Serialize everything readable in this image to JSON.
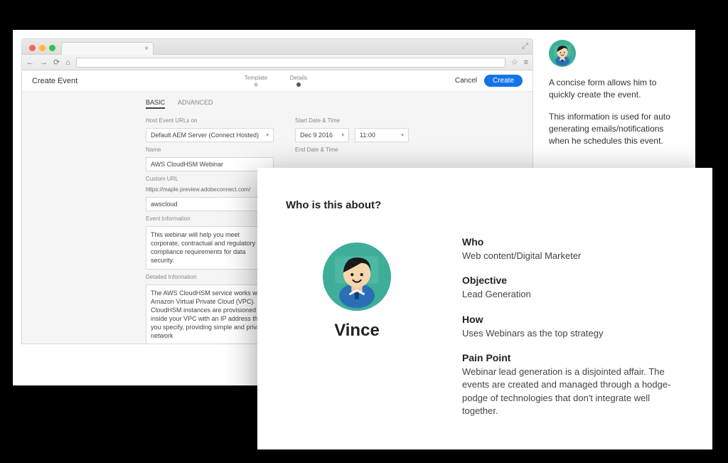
{
  "card1": {
    "browser": {
      "tab_close": "×",
      "nav_back": "←",
      "nav_fwd": "→",
      "nav_reload": "⟳",
      "nav_home": "⌂",
      "star": "☆",
      "expand": "⤢"
    },
    "header": {
      "title": "Create Event",
      "step1": "Template",
      "step2": "Details",
      "cancel": "Cancel",
      "create": "Create"
    },
    "tabs": {
      "basic": "BASIC",
      "advanced": "ADVANCED"
    },
    "left": {
      "host_label": "Host Event URLs on",
      "host_value": "Default AEM Server (Connect Hosted)",
      "name_label": "Name",
      "name_value": "AWS CloudHSM Webinar",
      "custom_url_label": "Custom URL",
      "custom_url_prefix": "https://maple.preview.adobeconnect.com/",
      "custom_url_value": "awscloud",
      "event_info_label": "Event Information",
      "event_info_value": "This webinar will help you meet corporate, contractual and regulatory compliance requirements for data security.",
      "detailed_label": "Detailed Information",
      "detailed_value": "The AWS CloudHSM service works with Amazon Virtual Private Cloud (VPC). CloudHSM instances are provisioned inside your VPC with an IP address that you specify, providing simple and private network"
    },
    "right": {
      "start_label": "Start Date & Time",
      "start_date": "Dec 9 2016",
      "start_time": "11:00",
      "end_label": "End Date & Time"
    },
    "description": {
      "p1": "A concise form allows him to quickly create the event.",
      "p2": "This information is used for auto generating emails/notifications when he schedules this event."
    }
  },
  "card2": {
    "heading": "Who is this about?",
    "name": "Vince",
    "who_k": "Who",
    "who_v": "Web content/Digital Marketer",
    "obj_k": "Objective",
    "obj_v": "Lead Generation",
    "how_k": "How",
    "how_v": "Uses Webinars as the top strategy",
    "pain_k": "Pain Point",
    "pain_v": "Webinar lead generation is a disjointed affair. The events are created and managed through a hodge-podge of technologies that don't integrate well together."
  }
}
